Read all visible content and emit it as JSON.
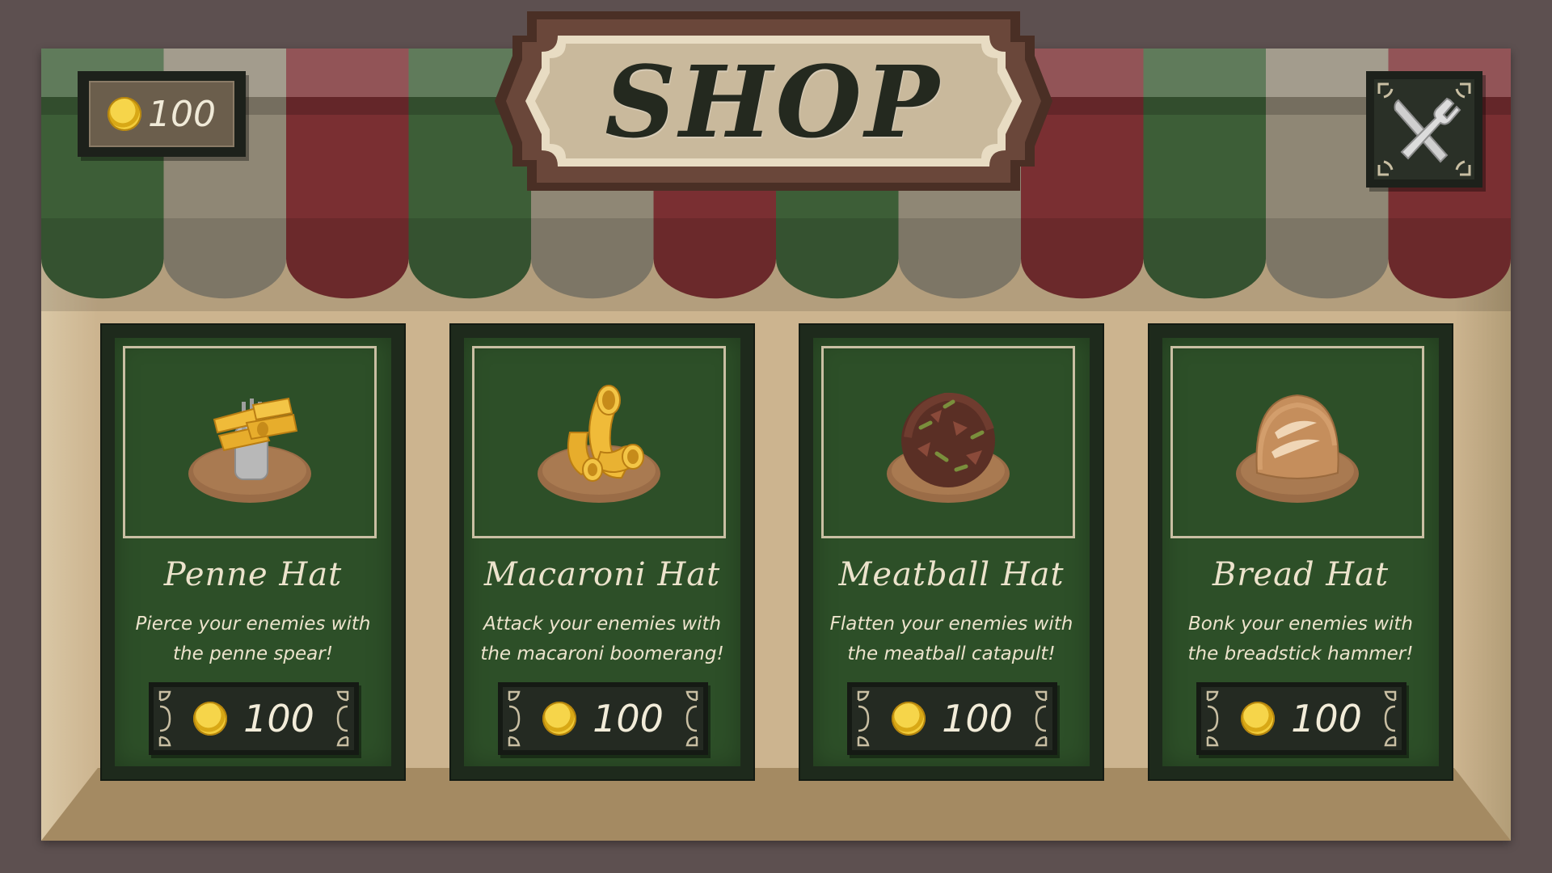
{
  "shop": {
    "title": "SHOP",
    "coins": "100",
    "colors": {
      "green": "#3d5e37",
      "beige": "#8f8775",
      "red": "#7a2f32",
      "board": "#ccb48f"
    }
  },
  "close_button": {
    "icon": "fork-knife-icon"
  },
  "items": [
    {
      "name": "Penne Hat",
      "description_line1": "Pierce your enemies with",
      "description_line2": "the penne spear!",
      "price": "100",
      "icon": "penne-hat-icon"
    },
    {
      "name": "Macaroni Hat",
      "description_line1": "Attack your enemies with",
      "description_line2": "the macaroni boomerang!",
      "price": "100",
      "icon": "macaroni-hat-icon"
    },
    {
      "name": "Meatball Hat",
      "description_line1": "Flatten your enemies with",
      "description_line2": "the meatball catapult!",
      "price": "100",
      "icon": "meatball-hat-icon"
    },
    {
      "name": "Bread Hat",
      "description_line1": "Bonk your enemies with",
      "description_line2": "the breadstick hammer!",
      "price": "100",
      "icon": "bread-hat-icon"
    }
  ]
}
